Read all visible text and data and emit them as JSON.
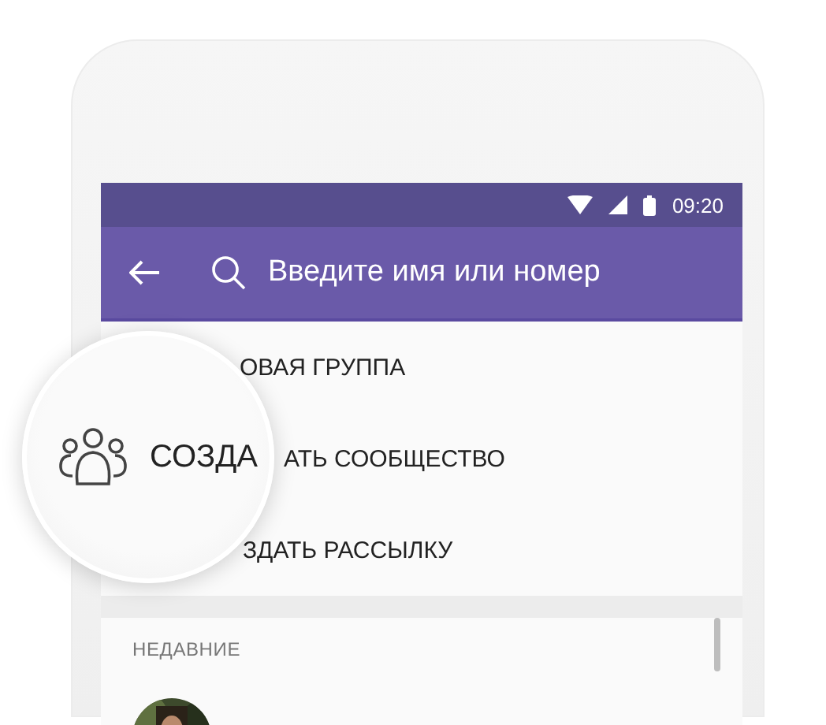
{
  "status_bar": {
    "time": "09:20"
  },
  "app_bar": {
    "search": {
      "placeholder": "Введите имя или номер"
    }
  },
  "menu": [
    {
      "label": "ОВАЯ ГРУППА"
    },
    {
      "label": "АТЬ СООБЩЕСТВО"
    },
    {
      "label": "ЗДАТЬ РАССЫЛКУ"
    }
  ],
  "magnifier": {
    "label": "СОЗДА"
  },
  "recent": {
    "header": "НЕДАВНИЕ"
  }
}
